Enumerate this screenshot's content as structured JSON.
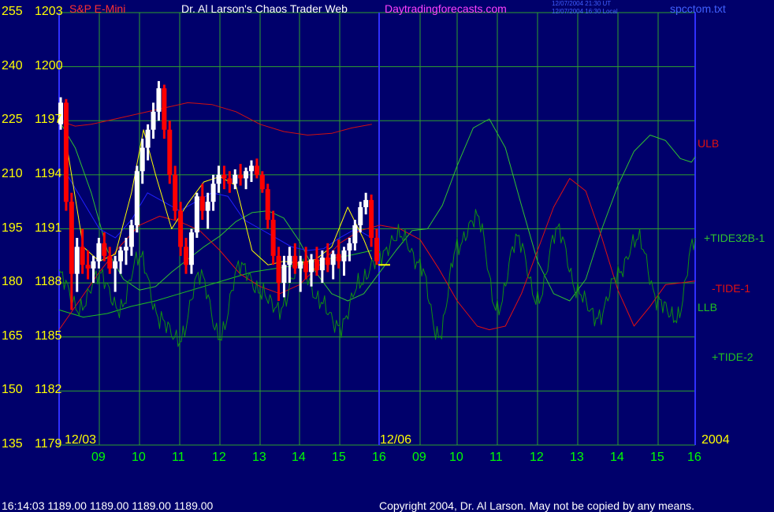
{
  "header": {
    "symbol": "S&P E-Mini",
    "title": "Dr. Al Larson's Chaos Trader Web",
    "site": "Daytradingforecasts.com",
    "time_ut": "12/07/2004 21:30 UT",
    "time_local": "12/07/2004 16:30 Local",
    "filename": "spcctom.txt"
  },
  "footer": {
    "quote": "16:14:03   1189.00  1189.00  1189.00  1189.00",
    "copyright": "Copyright 2004, Dr. Al Larson. May not be copied by any means."
  },
  "colors": {
    "background": "#00006b",
    "grid": "#2ea02e",
    "price_up": "#ffffff",
    "price_down": "#ff0000",
    "ulb": "#d01010",
    "llb": "#20c020",
    "tide32b1": "#30c030",
    "tide1": "#e01010",
    "tide2": "#109010",
    "ma_yellow": "#ffff00",
    "ma_blue": "#2020ff"
  },
  "chart_data": {
    "type": "line",
    "y_left_ticks": [
      "255",
      "240",
      "225",
      "210",
      "195",
      "180",
      "165",
      "150",
      "135"
    ],
    "y_right_ticks": [
      "1203",
      "1200",
      "1197",
      "1194",
      "1191",
      "1188",
      "1185",
      "1182",
      "1179"
    ],
    "ylim": [
      1179,
      1203
    ],
    "hour_ticks": [
      "09",
      "10",
      "11",
      "12",
      "13",
      "14",
      "15",
      "16",
      "09",
      "10",
      "11",
      "12",
      "13",
      "14",
      "15",
      "16"
    ],
    "date_labels": [
      "12/03",
      "12/06",
      "2004"
    ],
    "series_labels": {
      "ulb": "ULB",
      "tide32b1": "+TIDE32B-1",
      "tide1": "-TIDE-1",
      "llb": "LLB",
      "tide2": "+TIDE-2"
    },
    "price_bars": [
      [
        1196.8,
        1198.3,
        1196.5,
        1198.0
      ],
      [
        1198.0,
        1198.2,
        1192.0,
        1192.5
      ],
      [
        1192.5,
        1193.0,
        1186.5,
        1188.5
      ],
      [
        1188.5,
        1190.5,
        1187.5,
        1190.0
      ],
      [
        1190.0,
        1191.0,
        1188.5,
        1189.0
      ],
      [
        1189.0,
        1189.8,
        1188.2,
        1188.8
      ],
      [
        1188.8,
        1189.5,
        1188.0,
        1189.2
      ],
      [
        1189.2,
        1190.5,
        1188.8,
        1190.2
      ],
      [
        1190.2,
        1190.8,
        1189.2,
        1189.5
      ],
      [
        1189.5,
        1190.0,
        1188.5,
        1188.8
      ],
      [
        1188.8,
        1189.5,
        1187.5,
        1189.2
      ],
      [
        1189.2,
        1190.0,
        1188.5,
        1189.8
      ],
      [
        1189.8,
        1190.5,
        1189.0,
        1190.0
      ],
      [
        1190.0,
        1191.5,
        1189.5,
        1191.2
      ],
      [
        1191.2,
        1194.5,
        1190.8,
        1194.2
      ],
      [
        1194.2,
        1196.0,
        1193.5,
        1195.5
      ],
      [
        1195.5,
        1196.8,
        1194.8,
        1196.5
      ],
      [
        1196.5,
        1198.0,
        1196.0,
        1197.5
      ],
      [
        1197.5,
        1199.2,
        1197.0,
        1198.8
      ],
      [
        1198.8,
        1199.0,
        1196.0,
        1196.5
      ],
      [
        1196.5,
        1197.0,
        1193.5,
        1194.0
      ],
      [
        1194.0,
        1194.5,
        1191.5,
        1192.0
      ],
      [
        1192.0,
        1192.5,
        1189.5,
        1190.0
      ],
      [
        1190.0,
        1190.5,
        1188.5,
        1189.0
      ],
      [
        1189.0,
        1191.0,
        1188.5,
        1190.8
      ],
      [
        1190.8,
        1193.0,
        1190.5,
        1192.8
      ],
      [
        1192.8,
        1193.5,
        1191.5,
        1192.0
      ],
      [
        1192.0,
        1193.0,
        1191.0,
        1192.5
      ],
      [
        1192.5,
        1194.0,
        1192.0,
        1193.5
      ],
      [
        1193.5,
        1194.5,
        1193.0,
        1194.0
      ],
      [
        1194.0,
        1194.5,
        1193.2,
        1193.8
      ],
      [
        1193.8,
        1194.2,
        1193.0,
        1193.5
      ],
      [
        1193.5,
        1194.3,
        1193.2,
        1194.0
      ],
      [
        1194.0,
        1194.6,
        1193.4,
        1193.8
      ],
      [
        1193.8,
        1194.4,
        1193.2,
        1194.2
      ],
      [
        1194.2,
        1194.8,
        1193.6,
        1194.5
      ],
      [
        1194.5,
        1194.9,
        1193.8,
        1194.0
      ],
      [
        1194.0,
        1194.2,
        1193.0,
        1193.2
      ],
      [
        1193.2,
        1193.5,
        1191.0,
        1191.5
      ],
      [
        1191.5,
        1192.0,
        1189.0,
        1189.5
      ],
      [
        1189.5,
        1190.0,
        1187.0,
        1188.0
      ],
      [
        1188.0,
        1189.5,
        1187.2,
        1189.0
      ],
      [
        1189.0,
        1190.0,
        1188.0,
        1189.5
      ],
      [
        1189.5,
        1190.2,
        1188.5,
        1188.8
      ],
      [
        1188.8,
        1189.5,
        1187.5,
        1189.2
      ],
      [
        1189.2,
        1190.0,
        1188.2,
        1188.6
      ],
      [
        1188.6,
        1189.6,
        1187.8,
        1189.3
      ],
      [
        1189.3,
        1190.0,
        1188.4,
        1188.7
      ],
      [
        1188.7,
        1189.8,
        1188.0,
        1189.4
      ],
      [
        1189.4,
        1190.2,
        1188.6,
        1189.0
      ],
      [
        1189.0,
        1189.8,
        1188.2,
        1189.6
      ],
      [
        1189.6,
        1190.4,
        1188.8,
        1189.2
      ],
      [
        1189.2,
        1190.0,
        1188.4,
        1189.8
      ],
      [
        1189.8,
        1190.5,
        1189.2,
        1190.2
      ],
      [
        1190.2,
        1191.5,
        1189.8,
        1191.2
      ],
      [
        1191.2,
        1192.5,
        1190.8,
        1192.2
      ],
      [
        1192.2,
        1193.0,
        1191.8,
        1192.6
      ],
      [
        1192.6,
        1192.9,
        1190.0,
        1190.5
      ],
      [
        1190.5,
        1191.0,
        1189.0,
        1189.2
      ]
    ],
    "ulb": [
      [
        0.0,
        1197.0
      ],
      [
        0.4,
        1196.7
      ],
      [
        0.8,
        1196.8
      ],
      [
        1.4,
        1197.1
      ],
      [
        2.0,
        1197.4
      ],
      [
        2.6,
        1197.7
      ],
      [
        3.2,
        1198.0
      ],
      [
        3.8,
        1197.9
      ],
      [
        4.4,
        1197.5
      ],
      [
        5.0,
        1196.8
      ],
      [
        5.6,
        1196.4
      ],
      [
        6.2,
        1196.2
      ],
      [
        6.8,
        1196.3
      ],
      [
        7.3,
        1196.6
      ],
      [
        7.8,
        1196.8
      ]
    ],
    "llb": [
      [
        0.0,
        1186.5
      ],
      [
        0.6,
        1186.1
      ],
      [
        1.2,
        1186.3
      ],
      [
        1.8,
        1186.7
      ],
      [
        2.4,
        1187.0
      ],
      [
        3.0,
        1187.4
      ],
      [
        3.6,
        1187.8
      ],
      [
        4.2,
        1188.2
      ],
      [
        4.8,
        1188.6
      ],
      [
        5.4,
        1188.8
      ],
      [
        6.0,
        1189.0
      ],
      [
        6.6,
        1189.3
      ],
      [
        7.2,
        1189.5
      ],
      [
        7.8,
        1189.8
      ]
    ],
    "tide32b1": [
      [
        0.0,
        1197.0
      ],
      [
        0.4,
        1195.5
      ],
      [
        0.8,
        1193.0
      ],
      [
        1.2,
        1189.8
      ],
      [
        1.6,
        1188.2
      ],
      [
        2.0,
        1187.6
      ],
      [
        2.4,
        1187.8
      ],
      [
        2.8,
        1188.6
      ],
      [
        3.2,
        1189.3
      ],
      [
        3.6,
        1190.0
      ],
      [
        4.0,
        1190.6
      ],
      [
        4.4,
        1191.4
      ],
      [
        4.8,
        1191.9
      ],
      [
        5.2,
        1192.0
      ],
      [
        5.6,
        1191.6
      ],
      [
        6.0,
        1190.3
      ],
      [
        6.4,
        1188.6
      ],
      [
        6.8,
        1187.4
      ],
      [
        7.2,
        1187.0
      ],
      [
        7.6,
        1187.4
      ],
      [
        8.0,
        1188.6
      ],
      [
        8.4,
        1189.8
      ],
      [
        8.8,
        1190.9
      ],
      [
        9.2,
        1191.0
      ],
      [
        9.6,
        1192.3
      ],
      [
        10.0,
        1194.5
      ],
      [
        10.4,
        1196.6
      ],
      [
        10.8,
        1197.1
      ],
      [
        11.2,
        1195.5
      ],
      [
        11.6,
        1192.3
      ],
      [
        12.0,
        1189.2
      ],
      [
        12.4,
        1187.4
      ],
      [
        12.8,
        1187.0
      ],
      [
        13.2,
        1188.2
      ],
      [
        13.6,
        1191.0
      ],
      [
        14.0,
        1193.4
      ],
      [
        14.4,
        1195.3
      ],
      [
        14.8,
        1196.2
      ],
      [
        15.2,
        1195.9
      ],
      [
        15.6,
        1194.9
      ],
      [
        15.9,
        1194.7
      ],
      [
        16.0,
        1195.0
      ]
    ],
    "tide1": [
      [
        0.0,
        1185.4
      ],
      [
        0.5,
        1187.0
      ],
      [
        1.0,
        1188.6
      ],
      [
        1.5,
        1190.0
      ],
      [
        2.0,
        1191.2
      ],
      [
        2.5,
        1191.7
      ],
      [
        3.0,
        1191.4
      ],
      [
        3.5,
        1190.9
      ],
      [
        4.0,
        1189.8
      ],
      [
        4.5,
        1188.5
      ],
      [
        5.0,
        1187.8
      ],
      [
        5.5,
        1187.4
      ],
      [
        6.0,
        1187.9
      ],
      [
        6.5,
        1189.0
      ],
      [
        7.0,
        1190.2
      ],
      [
        7.5,
        1190.9
      ],
      [
        8.0,
        1191.2
      ],
      [
        8.5,
        1191.0
      ],
      [
        9.0,
        1190.4
      ],
      [
        9.5,
        1188.8
      ],
      [
        10.0,
        1187.0
      ],
      [
        10.5,
        1185.6
      ],
      [
        10.8,
        1185.4
      ],
      [
        11.2,
        1185.6
      ],
      [
        11.6,
        1187.4
      ],
      [
        12.0,
        1189.8
      ],
      [
        12.4,
        1192.2
      ],
      [
        12.8,
        1193.8
      ],
      [
        13.2,
        1193.1
      ],
      [
        13.6,
        1190.5
      ],
      [
        14.0,
        1187.6
      ],
      [
        14.4,
        1185.6
      ],
      [
        14.8,
        1186.7
      ],
      [
        15.2,
        1187.9
      ],
      [
        15.6,
        1188.0
      ],
      [
        16.0,
        1188.1
      ]
    ],
    "tide2_knots": [
      [
        0.0,
        1188.5
      ],
      [
        0.5,
        1186.5
      ],
      [
        1.0,
        1188.5
      ],
      [
        1.5,
        1186.5
      ],
      [
        2.0,
        1189.5
      ],
      [
        2.5,
        1186.0
      ],
      [
        3.0,
        1184.8
      ],
      [
        3.5,
        1188.5
      ],
      [
        4.0,
        1185.0
      ],
      [
        4.5,
        1189.0
      ],
      [
        5.0,
        1187.5
      ],
      [
        5.5,
        1186.5
      ],
      [
        6.0,
        1189.0
      ],
      [
        6.5,
        1187.0
      ],
      [
        7.0,
        1185.5
      ],
      [
        7.5,
        1188.0
      ],
      [
        8.0,
        1189.5
      ],
      [
        8.5,
        1190.7
      ],
      [
        9.0,
        1189.0
      ],
      [
        9.5,
        1185.0
      ],
      [
        10.0,
        1190.0
      ],
      [
        10.5,
        1191.7
      ],
      [
        11.0,
        1186.5
      ],
      [
        11.5,
        1190.5
      ],
      [
        12.0,
        1187.0
      ],
      [
        12.5,
        1191.0
      ],
      [
        13.0,
        1187.5
      ],
      [
        13.5,
        1186.0
      ],
      [
        14.0,
        1188.5
      ],
      [
        14.5,
        1190.5
      ],
      [
        15.0,
        1187.0
      ],
      [
        15.5,
        1186.0
      ],
      [
        16.0,
        1190.5
      ]
    ],
    "ma_yellow": [
      [
        0.2,
        1195.5
      ],
      [
        0.6,
        1190.0
      ],
      [
        1.0,
        1189.2
      ],
      [
        1.4,
        1189.6
      ],
      [
        1.8,
        1193.0
      ],
      [
        2.1,
        1196.5
      ],
      [
        2.4,
        1194.0
      ],
      [
        2.8,
        1191.0
      ],
      [
        3.2,
        1192.4
      ],
      [
        3.6,
        1193.6
      ],
      [
        4.0,
        1193.9
      ],
      [
        4.4,
        1193.4
      ],
      [
        4.8,
        1189.8
      ],
      [
        5.2,
        1189.0
      ],
      [
        5.6,
        1189.2
      ],
      [
        6.0,
        1189.1
      ],
      [
        6.4,
        1189.3
      ],
      [
        6.8,
        1190.0
      ],
      [
        7.2,
        1192.2
      ],
      [
        7.6,
        1190.4
      ],
      [
        7.8,
        1189.3
      ]
    ],
    "ma_blue": [
      [
        0.2,
        1194.0
      ],
      [
        0.6,
        1192.5
      ],
      [
        1.0,
        1191.0
      ],
      [
        1.4,
        1190.5
      ],
      [
        1.8,
        1191.5
      ],
      [
        2.2,
        1193.0
      ],
      [
        2.6,
        1192.5
      ],
      [
        3.0,
        1192.0
      ],
      [
        3.4,
        1192.5
      ],
      [
        3.8,
        1193.0
      ],
      [
        4.2,
        1192.8
      ],
      [
        4.6,
        1191.5
      ],
      [
        5.0,
        1191.0
      ],
      [
        5.4,
        1190.5
      ],
      [
        5.8,
        1190.0
      ],
      [
        6.2,
        1189.8
      ],
      [
        6.6,
        1189.9
      ],
      [
        7.0,
        1190.5
      ],
      [
        7.4,
        1191.0
      ],
      [
        7.8,
        1190.5
      ]
    ]
  }
}
